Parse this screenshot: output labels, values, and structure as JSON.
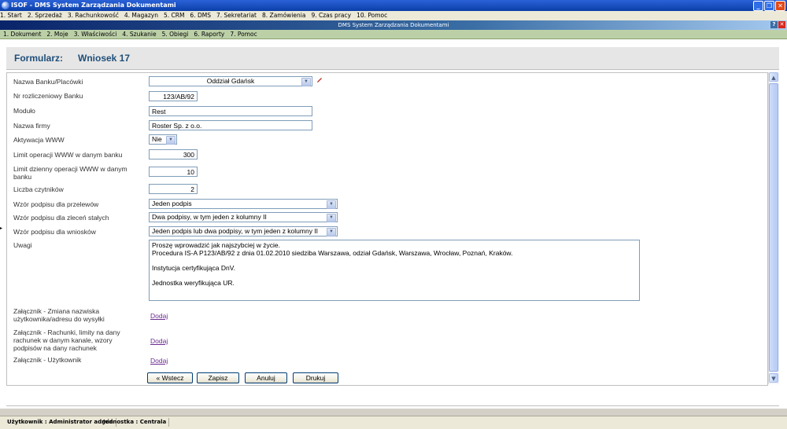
{
  "window": {
    "title": "ISOF - DMS System Zarządzania Dokumentami",
    "subwindow_title": "DMS System Zarządzania Dokumentami"
  },
  "main_menu": [
    "1. Start",
    "2. Sprzedaż",
    "3. Rachunkowość",
    "4. Magazyn",
    "5. CRM",
    "6. DMS",
    "7. Sekretariat",
    "8. Zamówienia",
    "9. Czas pracy",
    "10. Pomoc"
  ],
  "sub_menu": [
    "1. Dokument",
    "2. Moje",
    "3. Właściwości",
    "4. Szukanie",
    "5. Obiegi",
    "6. Raporty",
    "7. Pomoc"
  ],
  "form": {
    "label": "Formularz:",
    "name": "Wniosek 17",
    "fields": {
      "bank": {
        "label": "Nazwa Banku/Placówki",
        "value": "Oddział Gdańsk"
      },
      "clearing": {
        "label": "Nr rozliczeniowy Banku",
        "value": "123/AB/92"
      },
      "module": {
        "label": "Moduło",
        "value": "Rest"
      },
      "company": {
        "label": "Nazwa firmy",
        "value": "Roster Sp. z o.o."
      },
      "www": {
        "label": "Aktywacja WWW",
        "value": "Nie"
      },
      "limit_op": {
        "label": "Limit operacji WWW w danym banku",
        "value": "300"
      },
      "limit_day": {
        "label": "Limit dzienny operacji WWW w danym banku",
        "value": "10"
      },
      "readers": {
        "label": "Liczba czytników",
        "value": "2"
      },
      "sig_transfer": {
        "label": "Wzór podpisu dla przelewów",
        "value": "Jeden podpis"
      },
      "sig_standing": {
        "label": "Wzór podpisu dla zleceń stałych",
        "value": "Dwa podpisy, w tym jeden z kolumny II"
      },
      "sig_requests": {
        "label": "Wzór podpisu dla wniosków",
        "value": "Jeden podpis lub dwa podpisy, w tym jeden z kolumny II"
      },
      "notes": {
        "label": "Uwagi",
        "lines": [
          "Proszę wprowadzić jak najszybciej w życie.",
          "Procedura IS-A P123/AB/92 z dnia 01.02.2010 siedziba Warszawa, odział Gdańsk, Warszawa, Wrocław, Poznań, Kraków.",
          "",
          "Instytucja certyfikująca DnV.",
          "",
          "Jednostka weryfikująca UR."
        ]
      },
      "att1": {
        "label": "Załącznik - Zmiana nazwiska użytkownika/adresu do wysyłki",
        "link": "Dodaj"
      },
      "att2": {
        "label": "Załącznik - Rachunki, limity na dany rachunek w danym kanale, wzory podpisów na dany rachunek",
        "link": "Dodaj"
      },
      "att3": {
        "label": "Załącznik - Użytkownik",
        "link": "Dodaj"
      }
    },
    "buttons": {
      "back": "« Wstecz",
      "save": "Zapisz",
      "cancel": "Anuluj",
      "print": "Drukuj"
    }
  },
  "status": {
    "user": "Użytkownik : Administrator admin",
    "unit": "Jednostka : Centrala"
  }
}
